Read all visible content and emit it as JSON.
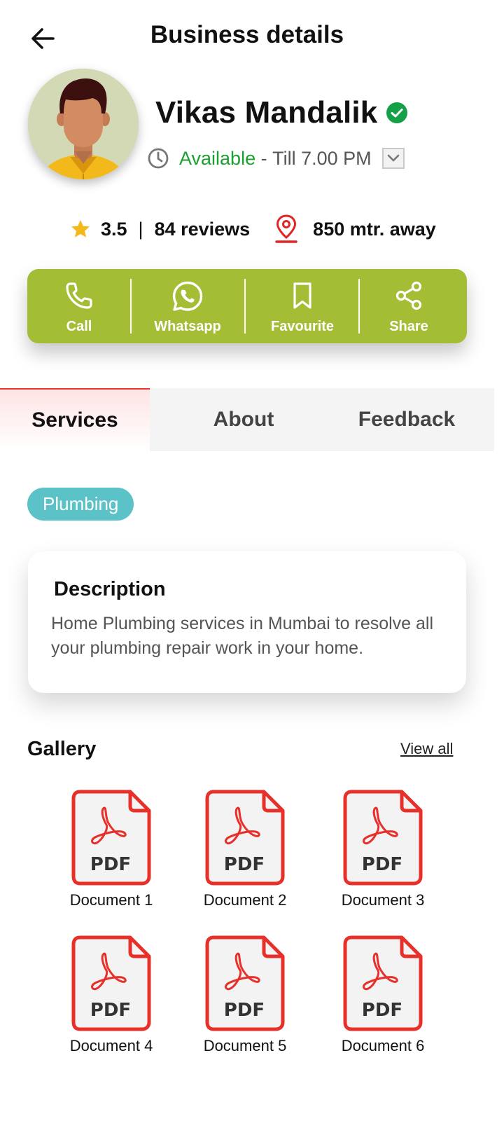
{
  "header": {
    "title": "Business details",
    "back_icon": "arrow-left-icon"
  },
  "business": {
    "name": "Vikas Mandalik",
    "verified": true,
    "availability_status": "Available",
    "availability_separator": " - ",
    "availability_until": "Till 7.00 PM",
    "rating": "3.5",
    "reviews": "84 reviews",
    "distance": "850 mtr. away"
  },
  "actions": [
    {
      "label": "Call",
      "icon": "phone-icon"
    },
    {
      "label": "Whatsapp",
      "icon": "whatsapp-icon"
    },
    {
      "label": "Favourite",
      "icon": "bookmark-icon"
    },
    {
      "label": "Share",
      "icon": "share-icon"
    }
  ],
  "tabs": [
    {
      "label": "Services",
      "active": true
    },
    {
      "label": "About",
      "active": false
    },
    {
      "label": "Feedback",
      "active": false
    }
  ],
  "service_chip": "Plumbing",
  "description": {
    "title": "Description",
    "text": "Home Plumbing services in Mumbai to resolve all your plumbing repair work in your home."
  },
  "gallery": {
    "title": "Gallery",
    "view_all": "View all",
    "pdf_badge": "PDF",
    "items": [
      {
        "label": "Document 1"
      },
      {
        "label": "Document 2"
      },
      {
        "label": "Document 3"
      },
      {
        "label": "Document 4"
      },
      {
        "label": "Document 5"
      },
      {
        "label": "Document 6"
      }
    ]
  },
  "colors": {
    "action_bar": "#a3be35",
    "available": "#1aa031",
    "verified": "#14a046",
    "chip": "#5bc2c8",
    "pdf_red": "#e8302a",
    "tab_active_border": "#e53935"
  }
}
